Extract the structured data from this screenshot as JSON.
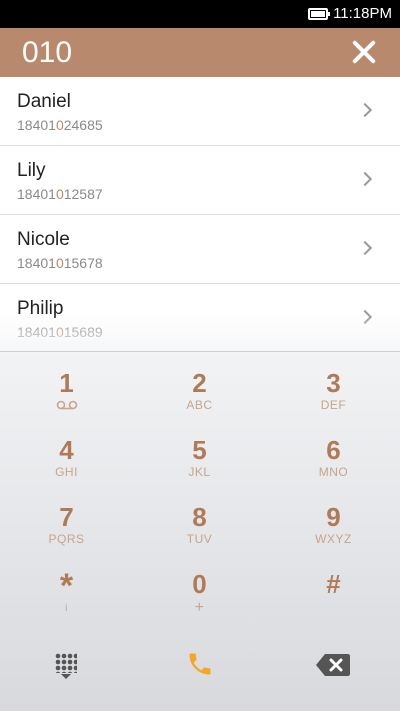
{
  "status_bar": {
    "time": "11:18PM",
    "battery_icon": "battery-full-icon"
  },
  "search": {
    "query": "010",
    "clear_icon": "close-icon"
  },
  "results": [
    {
      "name": "Daniel",
      "number_pre": "18401",
      "number_match": "0",
      "number_post": "24685"
    },
    {
      "name": "Lily",
      "number_pre": "18401",
      "number_match": "0",
      "number_post": "12587"
    },
    {
      "name": "Nicole",
      "number_pre": "18401",
      "number_match": "0",
      "number_post": "15678"
    },
    {
      "name": "Philip",
      "number_pre": "18401",
      "number_match": "0",
      "number_post": "15689"
    }
  ],
  "keypad": [
    {
      "digit": "1",
      "letters": ""
    },
    {
      "digit": "2",
      "letters": "ABC"
    },
    {
      "digit": "3",
      "letters": "DEF"
    },
    {
      "digit": "4",
      "letters": "GHI"
    },
    {
      "digit": "5",
      "letters": "JKL"
    },
    {
      "digit": "6",
      "letters": "MNO"
    },
    {
      "digit": "7",
      "letters": "PQRS"
    },
    {
      "digit": "8",
      "letters": "TUV"
    },
    {
      "digit": "9",
      "letters": "WXYZ"
    },
    {
      "digit": "*",
      "letters": ""
    },
    {
      "digit": "0",
      "letters": "+"
    },
    {
      "digit": "#",
      "letters": ""
    }
  ],
  "bottom_bar": {
    "left_icon": "dialpad-toggle-icon",
    "center_icon": "phone-call-icon",
    "right_icon": "backspace-icon"
  },
  "colors": {
    "accent": "#b8896c",
    "digit": "#b07a57",
    "call": "#f5a623"
  }
}
